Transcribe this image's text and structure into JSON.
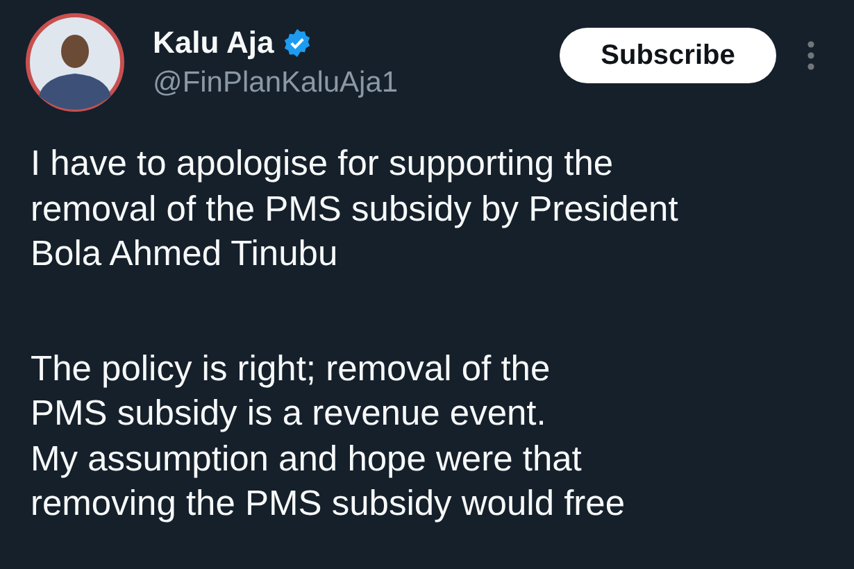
{
  "author": {
    "name": "Kalu Aja",
    "verified": true,
    "handle": "@FinPlanKaluAja1"
  },
  "subscribe_button": "Subscribe",
  "body": [
    {
      "lines": [
        "I have to apologise for supporting the",
        "removal of the PMS subsidy by President",
        "Bola Ahmed Tinubu"
      ]
    },
    {
      "lines": [
        "The policy is right; removal of the",
        "PMS subsidy is a revenue event.",
        "My assumption and hope were that",
        "removing the PMS subsidy would free"
      ]
    }
  ]
}
